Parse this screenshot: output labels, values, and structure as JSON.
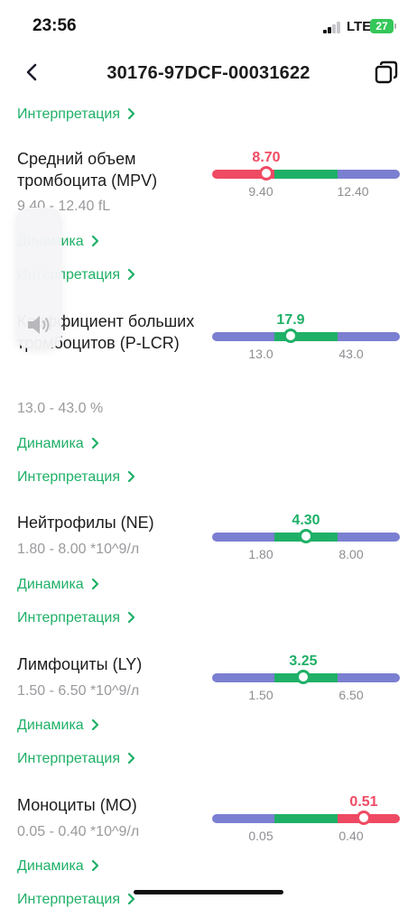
{
  "status": {
    "time": "23:56",
    "network": "LTE",
    "battery": "27"
  },
  "nav": {
    "title": "30176-97DCF-00031622",
    "back_icon": "chevron-left-icon",
    "copy_icon": "copy-icon"
  },
  "colors": {
    "low": "#ef4a63",
    "normal": "#1fb067",
    "outside": "#7b7fd1",
    "link": "#1fb067"
  },
  "top_link": "Интерпретация",
  "items": [
    {
      "name": "Средний объем тромбоцита (MPV)",
      "range": "9.40 - 12.40 fL",
      "value": "8.70",
      "status": "low",
      "ticks": [
        "9.40",
        "12.40"
      ],
      "dynamics_label": "Динамика",
      "interpretation_label": "Интерпретация"
    },
    {
      "name": "Коэффициент больших тромбоцитов (P-LCR)",
      "range": "13.0 - 43.0 %",
      "value": "17.9",
      "status": "normal",
      "ticks": [
        "13.0",
        "43.0"
      ],
      "dynamics_label": "Динамика",
      "interpretation_label": "Интерпретация"
    },
    {
      "name": "Нейтрофилы (NE)",
      "range": "1.80 - 8.00 *10^9/л",
      "value": "4.30",
      "status": "normal",
      "ticks": [
        "1.80",
        "8.00"
      ],
      "dynamics_label": "Динамика",
      "interpretation_label": "Интерпретация"
    },
    {
      "name": "Лимфоциты (LY)",
      "range": "1.50 - 6.50 *10^9/л",
      "value": "3.25",
      "status": "normal",
      "ticks": [
        "1.50",
        "6.50"
      ],
      "dynamics_label": "Динамика",
      "interpretation_label": "Интерпретация"
    },
    {
      "name": "Моноциты (MO)",
      "range": "0.05 - 0.40 *10^9/л",
      "value": "0.51",
      "status": "high",
      "ticks": [
        "0.05",
        "0.40"
      ],
      "dynamics_label": "Динамика",
      "interpretation_label": "Интерпретация"
    }
  ],
  "volume_hud": {
    "icon": "speaker-icon"
  }
}
